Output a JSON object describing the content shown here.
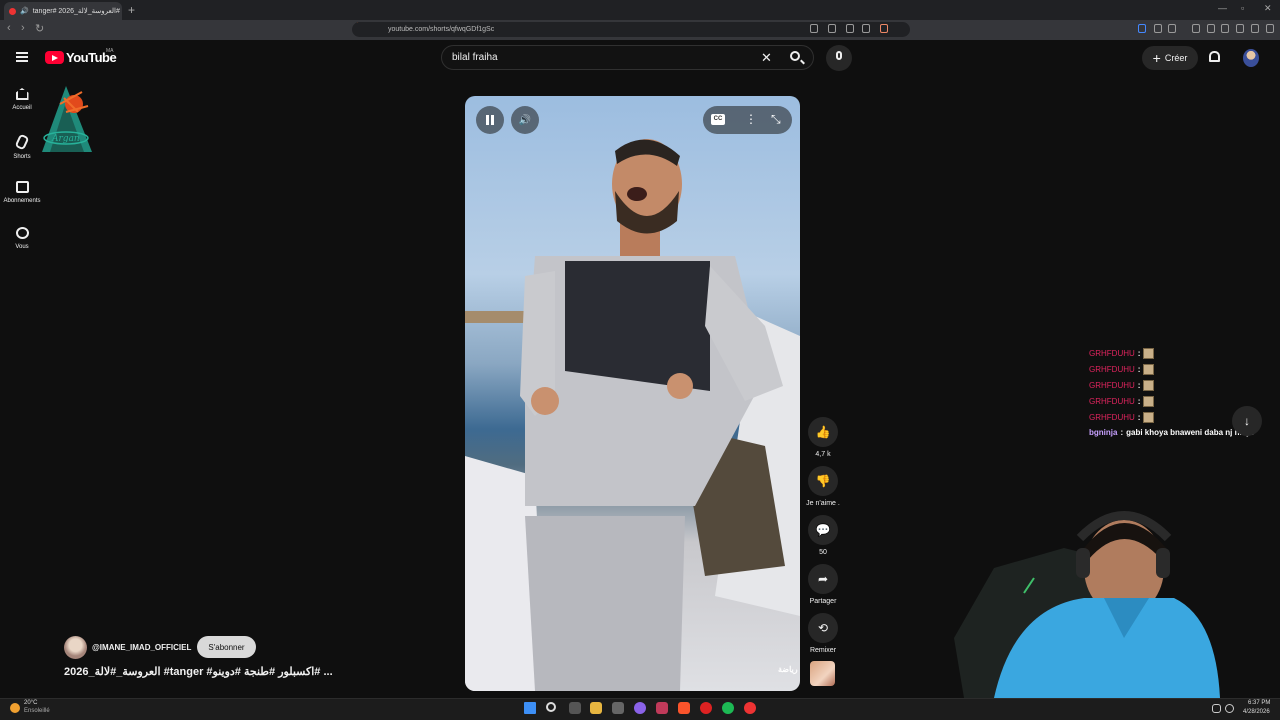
{
  "browser": {
    "tab_title": "tanger# 2026_العروسة_لالة#",
    "url": "youtube.com/shorts/qfwqGDf1gSc"
  },
  "youtube": {
    "logo_text": "YouTube",
    "country": "MA",
    "search_value": "bilal fraiha",
    "create_label": "Créer"
  },
  "sidebar": {
    "items": [
      {
        "label": "Accueil",
        "icon": "home-icon"
      },
      {
        "label": "Shorts",
        "icon": "shorts-icon"
      },
      {
        "label": "Abonnements",
        "icon": "subscriptions-icon"
      },
      {
        "label": "Vous",
        "icon": "you-icon"
      }
    ]
  },
  "overlay_logo": {
    "text": "Argan"
  },
  "video": {
    "watermark": "رياضة",
    "cc_label": "CC"
  },
  "actions": {
    "like_count": "4,7 k",
    "dislike_label": "Je n'aime .",
    "comments_count": "50",
    "share_label": "Partager",
    "remix_label": "Remixer"
  },
  "channel": {
    "name": "@IMANE_IMAD_OFFICIEL",
    "subscribe_label": "S'abonner",
    "title": "2026_العروسة_#لالة #tanger #اكسبلور #طنجة #دوينو# ..."
  },
  "chat": {
    "messages": [
      {
        "user": "GRHFDUHU",
        "sep": ":",
        "text": "",
        "emote": true
      },
      {
        "user": "GRHFDUHU",
        "sep": ":",
        "text": "",
        "emote": true
      },
      {
        "user": "GRHFDUHU",
        "sep": ":",
        "text": "",
        "emote": true
      },
      {
        "user": "GRHFDUHU",
        "sep": ":",
        "text": "",
        "emote": true
      },
      {
        "user": "GRHFDUHU",
        "sep": ":",
        "text": "",
        "emote": true
      },
      {
        "user": "bgninja",
        "sep": ":",
        "text": "gabi khoya bnaweni daba nj ninja",
        "emote": false
      }
    ]
  },
  "taskbar": {
    "weather_temp": "20°C",
    "weather_condition": "Ensoleillé",
    "time": "6:37 PM",
    "date": "4/28/2026"
  },
  "colors": {
    "youtube_red": "#ff0033",
    "background": "#0f0f0f",
    "chat_user_red": "#e0245e",
    "chat_user_lilac": "#c7a0ff"
  }
}
